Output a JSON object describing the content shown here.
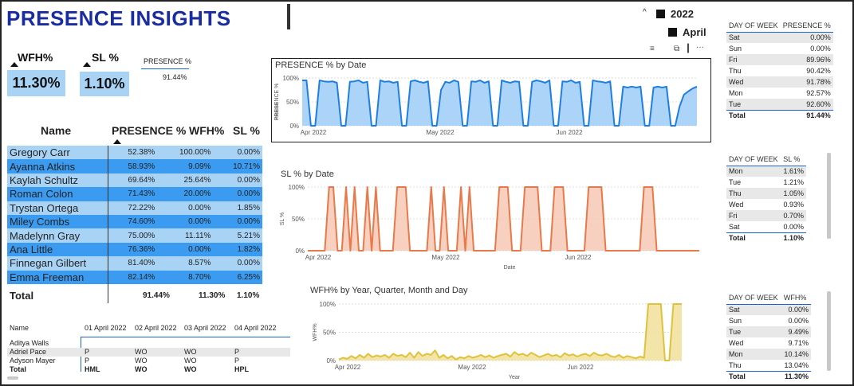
{
  "page_title": "PRESENCE INSIGHTS",
  "kpis": {
    "wfh_label": "WFH%",
    "wfh_value": "11.30%",
    "sl_label": "SL %",
    "sl_value": "1.10%",
    "presence_label": "PRESENCE %",
    "presence_value": "91.44%"
  },
  "slicer": {
    "year": "2022",
    "month": "April"
  },
  "names_table": {
    "headers": [
      "Name",
      "PRESENCE %",
      "WFH%",
      "SL %"
    ],
    "rows": [
      [
        "Gregory Carr",
        "52.38%",
        "100.00%",
        "0.00%"
      ],
      [
        "Ayanna Atkins",
        "58.93%",
        "9.09%",
        "10.71%"
      ],
      [
        "Kaylah Schultz",
        "69.64%",
        "25.64%",
        "0.00%"
      ],
      [
        "Roman Colon",
        "71.43%",
        "20.00%",
        "0.00%"
      ],
      [
        "Trystan Ortega",
        "72.22%",
        "0.00%",
        "1.85%"
      ],
      [
        "Miley Combs",
        "74.60%",
        "0.00%",
        "0.00%"
      ],
      [
        "Madelynn Gray",
        "75.00%",
        "11.11%",
        "5.21%"
      ],
      [
        "Ana Little",
        "76.36%",
        "0.00%",
        "1.82%"
      ],
      [
        "Finnegan Gilbert",
        "81.40%",
        "8.57%",
        "0.00%"
      ],
      [
        "Emma Freeman",
        "82.14%",
        "8.70%",
        "6.25%"
      ]
    ],
    "total": [
      "Total",
      "91.44%",
      "11.30%",
      "1.10%"
    ]
  },
  "attendance_table": {
    "headers": [
      "Name",
      "01 April 2022",
      "02 April 2022",
      "03 April 2022",
      "04 April 2022"
    ],
    "rows": [
      [
        "Aditya Walls",
        "",
        "",
        "",
        ""
      ],
      [
        "Adriel Pace",
        "P",
        "WO",
        "WO",
        "P"
      ],
      [
        "Adyson Mayer",
        "P",
        "WO",
        "WO",
        "P"
      ]
    ],
    "total": [
      "Total",
      "HML",
      "WO",
      "WO",
      "HPL"
    ]
  },
  "presence_dow": {
    "headers": [
      "DAY OF WEEK",
      "PRESENCE %"
    ],
    "rows": [
      [
        "Sat",
        "0.00%"
      ],
      [
        "Sun",
        "0.00%"
      ],
      [
        "Fri",
        "89.96%"
      ],
      [
        "Thu",
        "90.42%"
      ],
      [
        "Wed",
        "91.78%"
      ],
      [
        "Mon",
        "92.57%"
      ],
      [
        "Tue",
        "92.60%"
      ]
    ],
    "total": [
      "Total",
      "91.44%"
    ]
  },
  "sl_dow": {
    "headers": [
      "DAY OF WEEK",
      "SL %"
    ],
    "rows": [
      [
        "Mon",
        "1.61%"
      ],
      [
        "Tue",
        "1.21%"
      ],
      [
        "Thu",
        "1.05%"
      ],
      [
        "Wed",
        "0.93%"
      ],
      [
        "Fri",
        "0.70%"
      ],
      [
        "Sat",
        "0.00%"
      ]
    ],
    "total": [
      "Total",
      "1.10%"
    ]
  },
  "wfh_dow": {
    "headers": [
      "DAY OF WEEK",
      "WFH%"
    ],
    "rows": [
      [
        "Sat",
        "0.00%"
      ],
      [
        "Sun",
        "0.00%"
      ],
      [
        "Tue",
        "9.49%"
      ],
      [
        "Wed",
        "9.71%"
      ],
      [
        "Mon",
        "10.14%"
      ],
      [
        "Thu",
        "13.04%"
      ]
    ],
    "total": [
      "Total",
      "11.30%"
    ]
  },
  "colors": {
    "title": "#1a2da0",
    "kpi_bg": "#a9d3f5",
    "row_light": "#a9d3f5",
    "row_dark": "#3b9bf0",
    "presence_line": "#1f7fe0",
    "presence_fill": "#9ccdf7",
    "sl_line": "#e8794a",
    "sl_fill": "#f6c8b4",
    "wfh_line": "#e0c23a",
    "wfh_fill": "#f1df9a"
  },
  "chart_data": [
    {
      "type": "area",
      "title": "PRESENCE % by Date",
      "ylabel": "PRESENCE %",
      "xlabel": "",
      "x_ticks": [
        "Apr 2022",
        "May 2022",
        "Jun 2022"
      ],
      "y_ticks": [
        "0%",
        "50%",
        "100%"
      ],
      "ylim": [
        0,
        1
      ],
      "values": [
        0.95,
        0.95,
        0.0,
        0.0,
        0.95,
        0.93,
        0.92,
        0.93,
        0.9,
        0.0,
        0.0,
        0.92,
        0.93,
        0.95,
        0.9,
        0.92,
        0.0,
        0.0,
        0.95,
        0.92,
        0.93,
        0.9,
        0.92,
        0.0,
        0.0,
        0.93,
        0.95,
        0.92,
        0.9,
        0.93,
        0.0,
        0.0,
        0.75,
        0.92,
        0.9,
        0.95,
        0.92,
        0.0,
        0.0,
        0.93,
        0.92,
        0.95,
        0.9,
        0.93,
        0.0,
        0.0,
        0.95,
        0.92,
        0.9,
        0.93,
        0.92,
        0.0,
        0.0,
        0.92,
        0.95,
        0.93,
        0.9,
        0.95,
        0.0,
        0.0,
        0.93,
        0.92,
        0.95,
        0.9,
        0.92,
        0.0,
        0.0,
        0.95,
        0.93,
        0.92,
        0.9,
        0.93,
        0.0,
        0.0,
        0.82,
        0.8,
        0.82,
        0.8,
        0.82,
        0.0,
        0.0,
        0.8,
        0.82,
        0.8,
        0.82,
        0.0,
        0.0,
        0.4,
        0.65,
        0.72,
        0.78,
        0.82
      ]
    },
    {
      "type": "area",
      "title": "SL % by Date",
      "ylabel": "SL %",
      "xlabel": "Date",
      "x_ticks": [
        "Apr 2022",
        "May 2022",
        "Jun 2022"
      ],
      "y_ticks": [
        "0%",
        "50%",
        "100%"
      ],
      "ylim": [
        0,
        1
      ],
      "values": [
        0,
        0,
        0,
        0,
        0,
        1,
        1,
        0,
        0,
        1,
        0,
        1,
        0,
        0,
        1,
        0,
        1,
        0,
        0,
        0,
        0,
        1,
        1,
        1,
        0,
        0,
        0,
        0,
        0,
        1,
        0,
        0,
        1,
        0,
        0,
        0,
        1,
        0,
        1,
        0,
        0,
        0,
        0,
        0,
        0,
        1,
        1,
        1,
        0,
        0,
        0,
        1,
        1,
        1,
        1,
        0,
        0,
        0,
        1,
        1,
        1,
        0,
        0,
        0,
        0,
        0,
        1,
        1,
        1,
        1,
        0,
        0,
        0,
        0,
        0,
        0,
        0,
        0,
        0,
        1,
        1,
        1,
        0,
        0,
        0,
        0,
        0,
        0,
        0,
        0,
        0,
        0,
        0
      ]
    },
    {
      "type": "area",
      "title": "WFH% by Year, Quarter, Month and Day",
      "ylabel": "WFH%",
      "xlabel": "Year",
      "x_ticks": [
        "Apr 2022",
        "May 2022",
        "Jun 2022"
      ],
      "y_ticks": [
        "0%",
        "50%",
        "100%"
      ],
      "ylim": [
        0,
        1
      ],
      "values": [
        0.02,
        0.05,
        0.03,
        0.08,
        0.04,
        0.1,
        0.05,
        0.12,
        0.06,
        0.09,
        0.07,
        0.1,
        0.05,
        0.12,
        0.08,
        0.1,
        0.06,
        0.14,
        0.05,
        0.15,
        0.08,
        0.12,
        0.1,
        0.18,
        0.05,
        0.1,
        0.04,
        0.08,
        0.02,
        0.06,
        0.04,
        0.08,
        0.05,
        0.07,
        0.1,
        0.06,
        0.09,
        0.05,
        0.08,
        0.1,
        0.12,
        0.07,
        0.15,
        0.1,
        0.12,
        0.08,
        0.14,
        0.1,
        0.06,
        0.09,
        0.12,
        0.08,
        0.1,
        0.06,
        0.13,
        0.09,
        0.11,
        0.07,
        0.1,
        0.12,
        0.08,
        0.14,
        0.1,
        0.09,
        0.12,
        0.08,
        0.06,
        0.1,
        0.05,
        0.08,
        0.06,
        0.04,
        0.07,
        0.05,
        1.0,
        1.0,
        1.0,
        1.0,
        0.0,
        0.0,
        1.0,
        1.0,
        1.0
      ]
    }
  ]
}
